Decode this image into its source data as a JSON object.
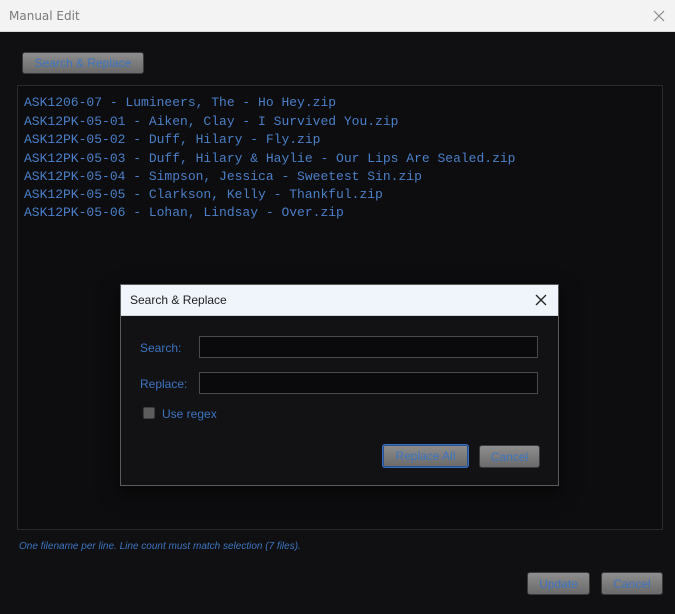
{
  "window": {
    "title": "Manual Edit"
  },
  "toolbar": {
    "search_replace_label": "Search & Replace"
  },
  "editor": {
    "lines": [
      "ASK1206-07 - Lumineers, The - Ho Hey.zip",
      "ASK12PK-05-01 - Aiken, Clay - I Survived You.zip",
      "ASK12PK-05-02 - Duff, Hilary - Fly.zip",
      "ASK12PK-05-03 - Duff, Hilary & Haylie - Our Lips Are Sealed.zip",
      "ASK12PK-05-04 - Simpson, Jessica - Sweetest Sin.zip",
      "ASK12PK-05-05 - Clarkson, Kelly - Thankful.zip",
      "ASK12PK-05-06 - Lohan, Lindsay - Over.zip"
    ]
  },
  "hint": "One filename per line. Line count must match selection (7 files).",
  "footer": {
    "update_label": "Update",
    "cancel_label": "Cancel"
  },
  "dialog": {
    "title": "Search & Replace",
    "search_label": "Search:",
    "search_value": "",
    "replace_label": "Replace:",
    "replace_value": "",
    "use_regex_label": "Use regex",
    "use_regex_checked": false,
    "replace_all_label": "Replace All",
    "cancel_label": "Cancel"
  },
  "colors": {
    "accent_text": "#3d74c0",
    "editor_text": "#4a7fc8",
    "background": "#101012"
  }
}
